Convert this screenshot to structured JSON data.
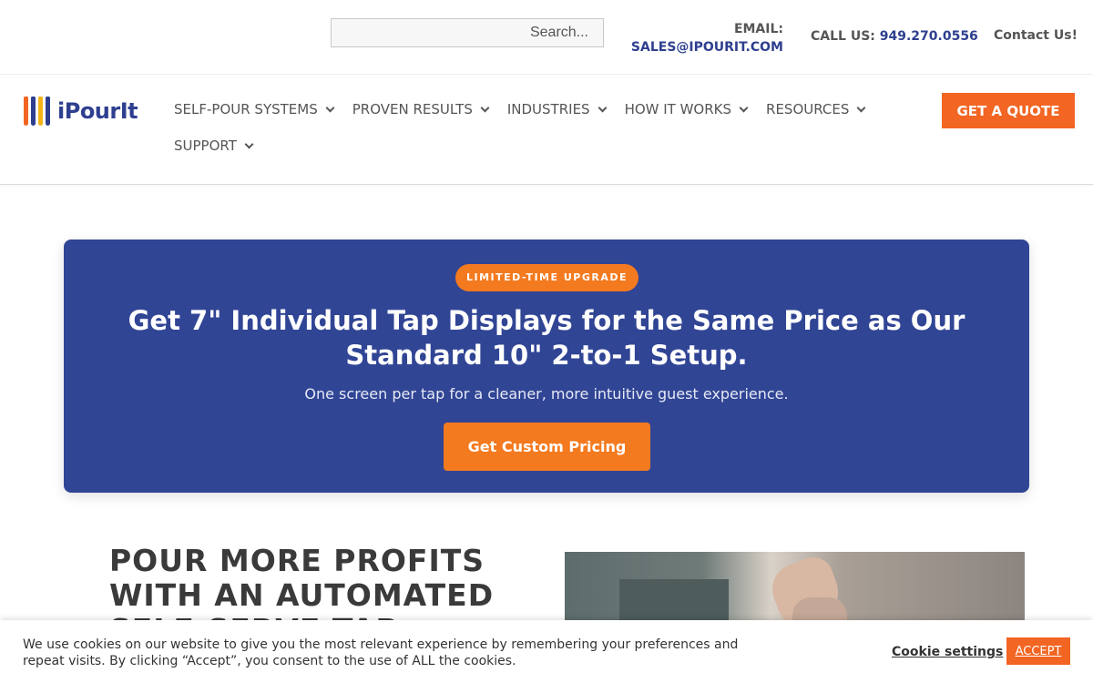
{
  "topbar": {
    "search_placeholder": "Search...",
    "email_label": "EMAIL:",
    "email_value": "SALES@IPOURIT.COM",
    "call_label": "CALL US:",
    "call_number": "949.270.0556",
    "contact_label": "Contact Us!"
  },
  "brand": {
    "name": "iPourIt",
    "tap_colors": [
      "#f26522",
      "#2e3f8f",
      "#f5b31a",
      "#2e3f8f"
    ],
    "primary_color": "#2e3f8f",
    "accent_color": "#f26522"
  },
  "nav": {
    "items": [
      {
        "label": "SELF-POUR SYSTEMS"
      },
      {
        "label": "PROVEN RESULTS"
      },
      {
        "label": "INDUSTRIES"
      },
      {
        "label": "HOW IT WORKS"
      },
      {
        "label": "RESOURCES"
      },
      {
        "label": "SUPPORT"
      }
    ],
    "quote_label": "GET A QUOTE"
  },
  "promo": {
    "badge": "LIMITED-TIME UPGRADE",
    "title": "Get 7\" Individual Tap Displays for the Same Price as Our Standard 10\" 2-to-1 Setup.",
    "subtitle": "One screen per tap for a cleaner, more intuitive guest experience.",
    "cta_label": "Get Custom Pricing",
    "background": "#314595"
  },
  "hero": {
    "heading": "POUR MORE PROFITS WITH AN AUTOMATED SELF-SERVE TAP"
  },
  "cookie": {
    "text": "We use cookies on our website to give you the most relevant experience by remembering your preferences and repeat visits. By clicking “Accept”, you consent to the use of ALL the cookies.",
    "settings_label": "Cookie settings",
    "accept_label": "ACCEPT"
  }
}
